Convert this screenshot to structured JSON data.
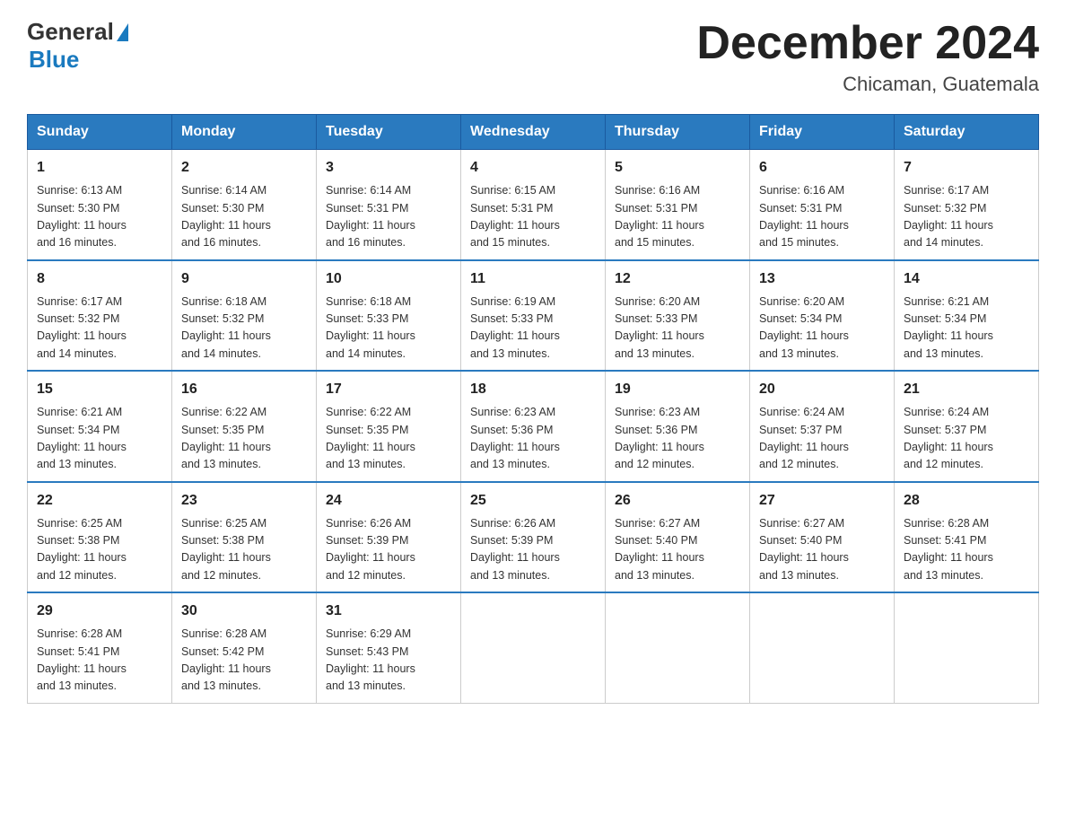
{
  "logo": {
    "general": "General",
    "blue": "Blue"
  },
  "header": {
    "month": "December 2024",
    "location": "Chicaman, Guatemala"
  },
  "days_of_week": [
    "Sunday",
    "Monday",
    "Tuesday",
    "Wednesday",
    "Thursday",
    "Friday",
    "Saturday"
  ],
  "weeks": [
    [
      {
        "day": "1",
        "sunrise": "6:13 AM",
        "sunset": "5:30 PM",
        "daylight": "11 hours and 16 minutes."
      },
      {
        "day": "2",
        "sunrise": "6:14 AM",
        "sunset": "5:30 PM",
        "daylight": "11 hours and 16 minutes."
      },
      {
        "day": "3",
        "sunrise": "6:14 AM",
        "sunset": "5:31 PM",
        "daylight": "11 hours and 16 minutes."
      },
      {
        "day": "4",
        "sunrise": "6:15 AM",
        "sunset": "5:31 PM",
        "daylight": "11 hours and 15 minutes."
      },
      {
        "day": "5",
        "sunrise": "6:16 AM",
        "sunset": "5:31 PM",
        "daylight": "11 hours and 15 minutes."
      },
      {
        "day": "6",
        "sunrise": "6:16 AM",
        "sunset": "5:31 PM",
        "daylight": "11 hours and 15 minutes."
      },
      {
        "day": "7",
        "sunrise": "6:17 AM",
        "sunset": "5:32 PM",
        "daylight": "11 hours and 14 minutes."
      }
    ],
    [
      {
        "day": "8",
        "sunrise": "6:17 AM",
        "sunset": "5:32 PM",
        "daylight": "11 hours and 14 minutes."
      },
      {
        "day": "9",
        "sunrise": "6:18 AM",
        "sunset": "5:32 PM",
        "daylight": "11 hours and 14 minutes."
      },
      {
        "day": "10",
        "sunrise": "6:18 AM",
        "sunset": "5:33 PM",
        "daylight": "11 hours and 14 minutes."
      },
      {
        "day": "11",
        "sunrise": "6:19 AM",
        "sunset": "5:33 PM",
        "daylight": "11 hours and 13 minutes."
      },
      {
        "day": "12",
        "sunrise": "6:20 AM",
        "sunset": "5:33 PM",
        "daylight": "11 hours and 13 minutes."
      },
      {
        "day": "13",
        "sunrise": "6:20 AM",
        "sunset": "5:34 PM",
        "daylight": "11 hours and 13 minutes."
      },
      {
        "day": "14",
        "sunrise": "6:21 AM",
        "sunset": "5:34 PM",
        "daylight": "11 hours and 13 minutes."
      }
    ],
    [
      {
        "day": "15",
        "sunrise": "6:21 AM",
        "sunset": "5:34 PM",
        "daylight": "11 hours and 13 minutes."
      },
      {
        "day": "16",
        "sunrise": "6:22 AM",
        "sunset": "5:35 PM",
        "daylight": "11 hours and 13 minutes."
      },
      {
        "day": "17",
        "sunrise": "6:22 AM",
        "sunset": "5:35 PM",
        "daylight": "11 hours and 13 minutes."
      },
      {
        "day": "18",
        "sunrise": "6:23 AM",
        "sunset": "5:36 PM",
        "daylight": "11 hours and 13 minutes."
      },
      {
        "day": "19",
        "sunrise": "6:23 AM",
        "sunset": "5:36 PM",
        "daylight": "11 hours and 12 minutes."
      },
      {
        "day": "20",
        "sunrise": "6:24 AM",
        "sunset": "5:37 PM",
        "daylight": "11 hours and 12 minutes."
      },
      {
        "day": "21",
        "sunrise": "6:24 AM",
        "sunset": "5:37 PM",
        "daylight": "11 hours and 12 minutes."
      }
    ],
    [
      {
        "day": "22",
        "sunrise": "6:25 AM",
        "sunset": "5:38 PM",
        "daylight": "11 hours and 12 minutes."
      },
      {
        "day": "23",
        "sunrise": "6:25 AM",
        "sunset": "5:38 PM",
        "daylight": "11 hours and 12 minutes."
      },
      {
        "day": "24",
        "sunrise": "6:26 AM",
        "sunset": "5:39 PM",
        "daylight": "11 hours and 12 minutes."
      },
      {
        "day": "25",
        "sunrise": "6:26 AM",
        "sunset": "5:39 PM",
        "daylight": "11 hours and 13 minutes."
      },
      {
        "day": "26",
        "sunrise": "6:27 AM",
        "sunset": "5:40 PM",
        "daylight": "11 hours and 13 minutes."
      },
      {
        "day": "27",
        "sunrise": "6:27 AM",
        "sunset": "5:40 PM",
        "daylight": "11 hours and 13 minutes."
      },
      {
        "day": "28",
        "sunrise": "6:28 AM",
        "sunset": "5:41 PM",
        "daylight": "11 hours and 13 minutes."
      }
    ],
    [
      {
        "day": "29",
        "sunrise": "6:28 AM",
        "sunset": "5:41 PM",
        "daylight": "11 hours and 13 minutes."
      },
      {
        "day": "30",
        "sunrise": "6:28 AM",
        "sunset": "5:42 PM",
        "daylight": "11 hours and 13 minutes."
      },
      {
        "day": "31",
        "sunrise": "6:29 AM",
        "sunset": "5:43 PM",
        "daylight": "11 hours and 13 minutes."
      },
      null,
      null,
      null,
      null
    ]
  ]
}
